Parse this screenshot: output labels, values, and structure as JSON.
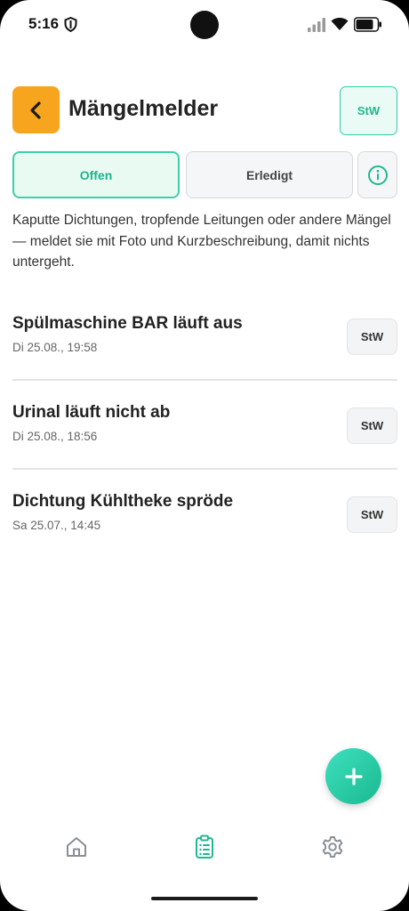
{
  "status_bar": {
    "time": "5:16"
  },
  "header": {
    "title": "Mängelmelder",
    "user_badge": "StW"
  },
  "tabs": {
    "open_label": "Offen",
    "done_label": "Erledigt"
  },
  "description": "Kaputte Dichtungen, tropfende Leitungen oder andere Mängel — meldet sie mit Foto und Kurzbeschreibung, damit nichts untergeht.",
  "items": [
    {
      "title": "Spülmaschine BAR läuft aus",
      "date": "Di 25.08., 19:58",
      "badge": "StW"
    },
    {
      "title": "Urinal läuft nicht ab",
      "date": "Di 25.08., 18:56",
      "badge": "StW"
    },
    {
      "title": "Dichtung Kühltheke spröde",
      "date": "Sa 25.07., 14:45",
      "badge": "StW"
    }
  ],
  "colors": {
    "accent": "#1fb890",
    "back_button": "#f7a51f"
  },
  "icons": {
    "back": "chevron-left-icon",
    "info": "info-icon",
    "add": "plus-icon",
    "nav_home": "home-icon",
    "nav_list": "clipboard-list-icon",
    "nav_settings": "gear-icon"
  }
}
